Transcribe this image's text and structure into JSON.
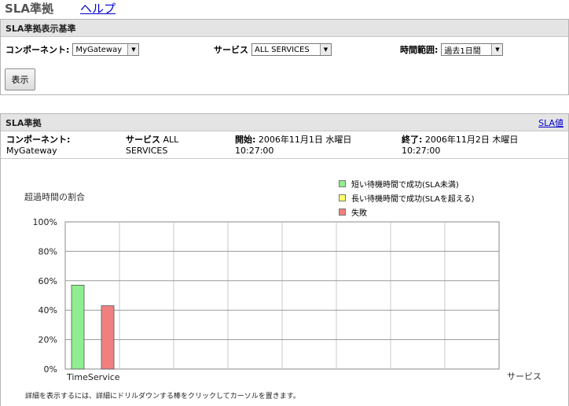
{
  "header": {
    "title": "SLA準拠",
    "help": "ヘルプ"
  },
  "criteria": {
    "title": "SLA準拠表示基準",
    "component_label": "コンポーネント:",
    "component_value": "MyGateway",
    "service_label": "サービス",
    "service_value": "ALL SERVICES",
    "time_label": "時間範囲:",
    "time_value": "過去1日間",
    "display_button": "表示"
  },
  "sla": {
    "title": "SLA準拠",
    "sla_value_link": "SLA値",
    "component_label": "コンポーネント:",
    "component_value": "MyGateway",
    "service_label": "サービス",
    "service_value_1": "ALL",
    "service_value_2": "SERVICES",
    "start_label": "開始:",
    "start_date": "2006年11月1日 水曜日",
    "start_time": "10:27:00",
    "end_label": "終了:",
    "end_date": "2006年11月2日 木曜日",
    "end_time": "10:27:00",
    "footnote": "詳細を表示するには、詳細にドリルダウンする棒をクリックしてカーソルを置きます。"
  },
  "chart_data": {
    "type": "bar",
    "ylabel": "超過時間の割合",
    "xlabel": "サービス",
    "categories": [
      "TimeService"
    ],
    "yticks": [
      "0%",
      "20%",
      "40%",
      "60%",
      "80%",
      "100%"
    ],
    "ylim": [
      0,
      100
    ],
    "grid": true,
    "legend_position": "top-right",
    "series": [
      {
        "name": "短い待機時間で成功(SLA未満)",
        "color": "#90ee90",
        "values": [
          57
        ]
      },
      {
        "name": "長い待機時間で成功(SLAを超える)",
        "color": "#ffff66",
        "values": [
          0
        ]
      },
      {
        "name": "失敗",
        "color": "#f08080",
        "values": [
          43
        ]
      }
    ]
  }
}
